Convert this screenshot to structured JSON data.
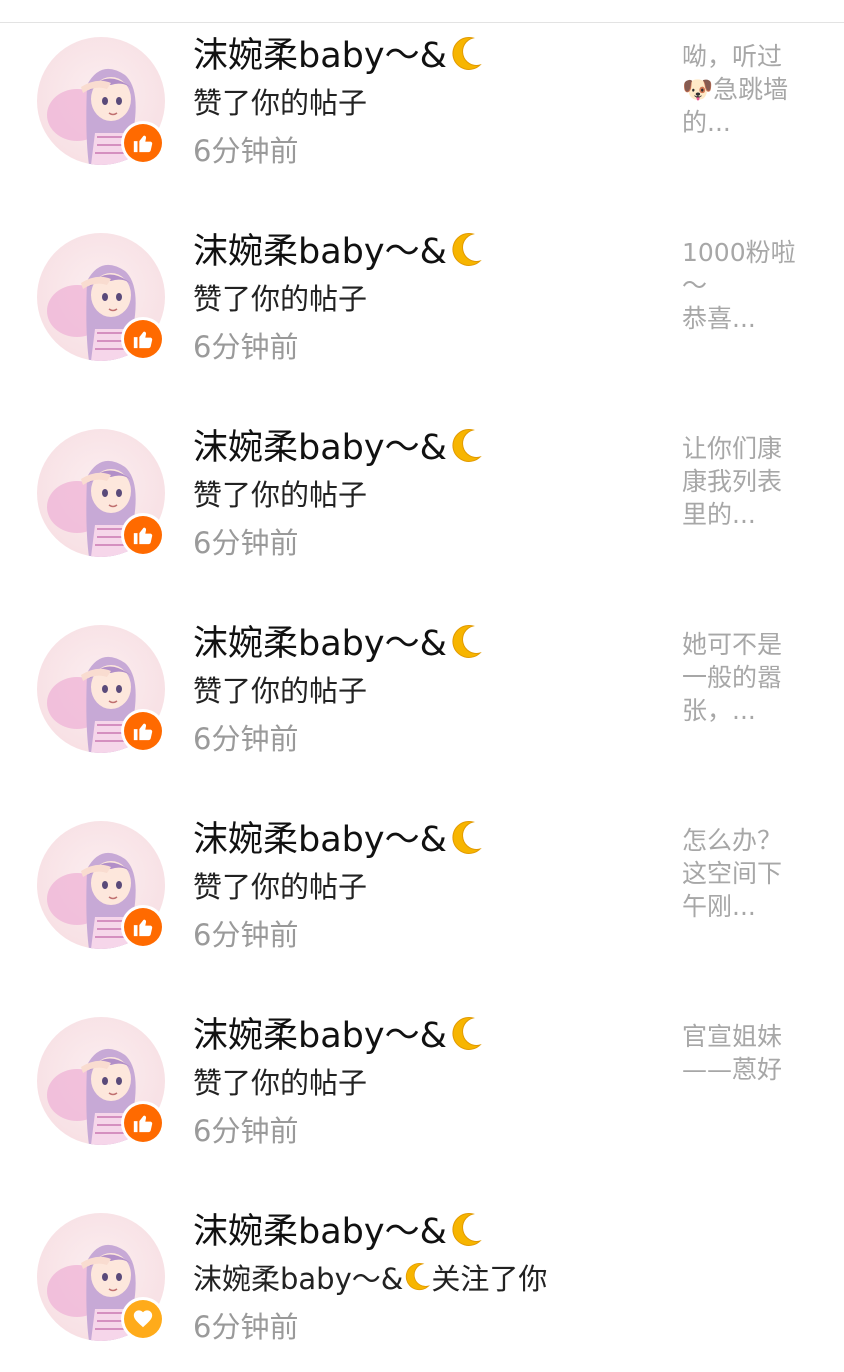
{
  "colors": {
    "like_badge": "#ff6a00",
    "follow_badge": "#ffab1a",
    "secondary_text": "#9a9a9a",
    "preview_text": "#a7a7a7"
  },
  "notifications": [
    {
      "user_name": "沫婉柔baby～&",
      "name_suffix_icon": "crescent-moon-emoji",
      "action": "赞了你的帖子",
      "time": "6分钟前",
      "badge": "thumbs-up-icon",
      "preview": "呦，听过\n🐶急跳墙\n的..."
    },
    {
      "user_name": "沫婉柔baby～&",
      "name_suffix_icon": "crescent-moon-emoji",
      "action": "赞了你的帖子",
      "time": "6分钟前",
      "badge": "thumbs-up-icon",
      "preview": "1000粉啦\n～\n恭喜..."
    },
    {
      "user_name": "沫婉柔baby～&",
      "name_suffix_icon": "crescent-moon-emoji",
      "action": "赞了你的帖子",
      "time": "6分钟前",
      "badge": "thumbs-up-icon",
      "preview": "让你们康\n康我列表\n里的..."
    },
    {
      "user_name": "沫婉柔baby～&",
      "name_suffix_icon": "crescent-moon-emoji",
      "action": "赞了你的帖子",
      "time": "6分钟前",
      "badge": "thumbs-up-icon",
      "preview": "她可不是\n一般的嚣\n张，..."
    },
    {
      "user_name": "沫婉柔baby～&",
      "name_suffix_icon": "crescent-moon-emoji",
      "action": "赞了你的帖子",
      "time": "6分钟前",
      "badge": "thumbs-up-icon",
      "preview": "怎么办？\n这空间下\n午刚..."
    },
    {
      "user_name": "沫婉柔baby～&",
      "name_suffix_icon": "crescent-moon-emoji",
      "action": "赞了你的帖子",
      "time": "6分钟前",
      "badge": "thumbs-up-icon",
      "preview": "官宣姐妹\n——蒽好"
    },
    {
      "user_name": "沫婉柔baby～&",
      "name_suffix_icon": "crescent-moon-emoji",
      "action_prefix": "沫婉柔baby～&",
      "action": "关注了你",
      "time": "6分钟前",
      "badge": "heart-icon",
      "preview": ""
    }
  ]
}
